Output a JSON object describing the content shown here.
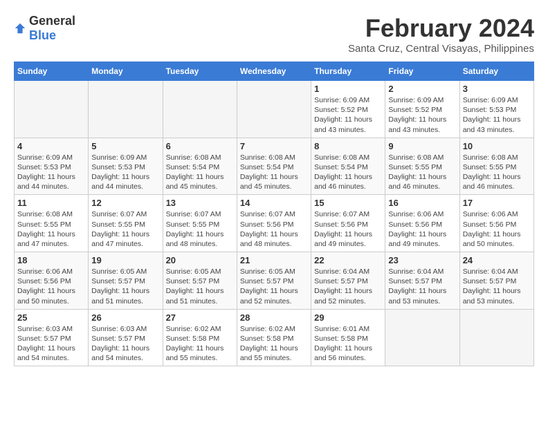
{
  "logo": {
    "text_general": "General",
    "text_blue": "Blue"
  },
  "title": "February 2024",
  "subtitle": "Santa Cruz, Central Visayas, Philippines",
  "headers": [
    "Sunday",
    "Monday",
    "Tuesday",
    "Wednesday",
    "Thursday",
    "Friday",
    "Saturday"
  ],
  "weeks": [
    [
      {
        "day": "",
        "info": ""
      },
      {
        "day": "",
        "info": ""
      },
      {
        "day": "",
        "info": ""
      },
      {
        "day": "",
        "info": ""
      },
      {
        "day": "1",
        "info": "Sunrise: 6:09 AM\nSunset: 5:52 PM\nDaylight: 11 hours and 43 minutes."
      },
      {
        "day": "2",
        "info": "Sunrise: 6:09 AM\nSunset: 5:52 PM\nDaylight: 11 hours and 43 minutes."
      },
      {
        "day": "3",
        "info": "Sunrise: 6:09 AM\nSunset: 5:53 PM\nDaylight: 11 hours and 43 minutes."
      }
    ],
    [
      {
        "day": "4",
        "info": "Sunrise: 6:09 AM\nSunset: 5:53 PM\nDaylight: 11 hours and 44 minutes."
      },
      {
        "day": "5",
        "info": "Sunrise: 6:09 AM\nSunset: 5:53 PM\nDaylight: 11 hours and 44 minutes."
      },
      {
        "day": "6",
        "info": "Sunrise: 6:08 AM\nSunset: 5:54 PM\nDaylight: 11 hours and 45 minutes."
      },
      {
        "day": "7",
        "info": "Sunrise: 6:08 AM\nSunset: 5:54 PM\nDaylight: 11 hours and 45 minutes."
      },
      {
        "day": "8",
        "info": "Sunrise: 6:08 AM\nSunset: 5:54 PM\nDaylight: 11 hours and 46 minutes."
      },
      {
        "day": "9",
        "info": "Sunrise: 6:08 AM\nSunset: 5:55 PM\nDaylight: 11 hours and 46 minutes."
      },
      {
        "day": "10",
        "info": "Sunrise: 6:08 AM\nSunset: 5:55 PM\nDaylight: 11 hours and 46 minutes."
      }
    ],
    [
      {
        "day": "11",
        "info": "Sunrise: 6:08 AM\nSunset: 5:55 PM\nDaylight: 11 hours and 47 minutes."
      },
      {
        "day": "12",
        "info": "Sunrise: 6:07 AM\nSunset: 5:55 PM\nDaylight: 11 hours and 47 minutes."
      },
      {
        "day": "13",
        "info": "Sunrise: 6:07 AM\nSunset: 5:55 PM\nDaylight: 11 hours and 48 minutes."
      },
      {
        "day": "14",
        "info": "Sunrise: 6:07 AM\nSunset: 5:56 PM\nDaylight: 11 hours and 48 minutes."
      },
      {
        "day": "15",
        "info": "Sunrise: 6:07 AM\nSunset: 5:56 PM\nDaylight: 11 hours and 49 minutes."
      },
      {
        "day": "16",
        "info": "Sunrise: 6:06 AM\nSunset: 5:56 PM\nDaylight: 11 hours and 49 minutes."
      },
      {
        "day": "17",
        "info": "Sunrise: 6:06 AM\nSunset: 5:56 PM\nDaylight: 11 hours and 50 minutes."
      }
    ],
    [
      {
        "day": "18",
        "info": "Sunrise: 6:06 AM\nSunset: 5:56 PM\nDaylight: 11 hours and 50 minutes."
      },
      {
        "day": "19",
        "info": "Sunrise: 6:05 AM\nSunset: 5:57 PM\nDaylight: 11 hours and 51 minutes."
      },
      {
        "day": "20",
        "info": "Sunrise: 6:05 AM\nSunset: 5:57 PM\nDaylight: 11 hours and 51 minutes."
      },
      {
        "day": "21",
        "info": "Sunrise: 6:05 AM\nSunset: 5:57 PM\nDaylight: 11 hours and 52 minutes."
      },
      {
        "day": "22",
        "info": "Sunrise: 6:04 AM\nSunset: 5:57 PM\nDaylight: 11 hours and 52 minutes."
      },
      {
        "day": "23",
        "info": "Sunrise: 6:04 AM\nSunset: 5:57 PM\nDaylight: 11 hours and 53 minutes."
      },
      {
        "day": "24",
        "info": "Sunrise: 6:04 AM\nSunset: 5:57 PM\nDaylight: 11 hours and 53 minutes."
      }
    ],
    [
      {
        "day": "25",
        "info": "Sunrise: 6:03 AM\nSunset: 5:57 PM\nDaylight: 11 hours and 54 minutes."
      },
      {
        "day": "26",
        "info": "Sunrise: 6:03 AM\nSunset: 5:57 PM\nDaylight: 11 hours and 54 minutes."
      },
      {
        "day": "27",
        "info": "Sunrise: 6:02 AM\nSunset: 5:58 PM\nDaylight: 11 hours and 55 minutes."
      },
      {
        "day": "28",
        "info": "Sunrise: 6:02 AM\nSunset: 5:58 PM\nDaylight: 11 hours and 55 minutes."
      },
      {
        "day": "29",
        "info": "Sunrise: 6:01 AM\nSunset: 5:58 PM\nDaylight: 11 hours and 56 minutes."
      },
      {
        "day": "",
        "info": ""
      },
      {
        "day": "",
        "info": ""
      }
    ]
  ]
}
